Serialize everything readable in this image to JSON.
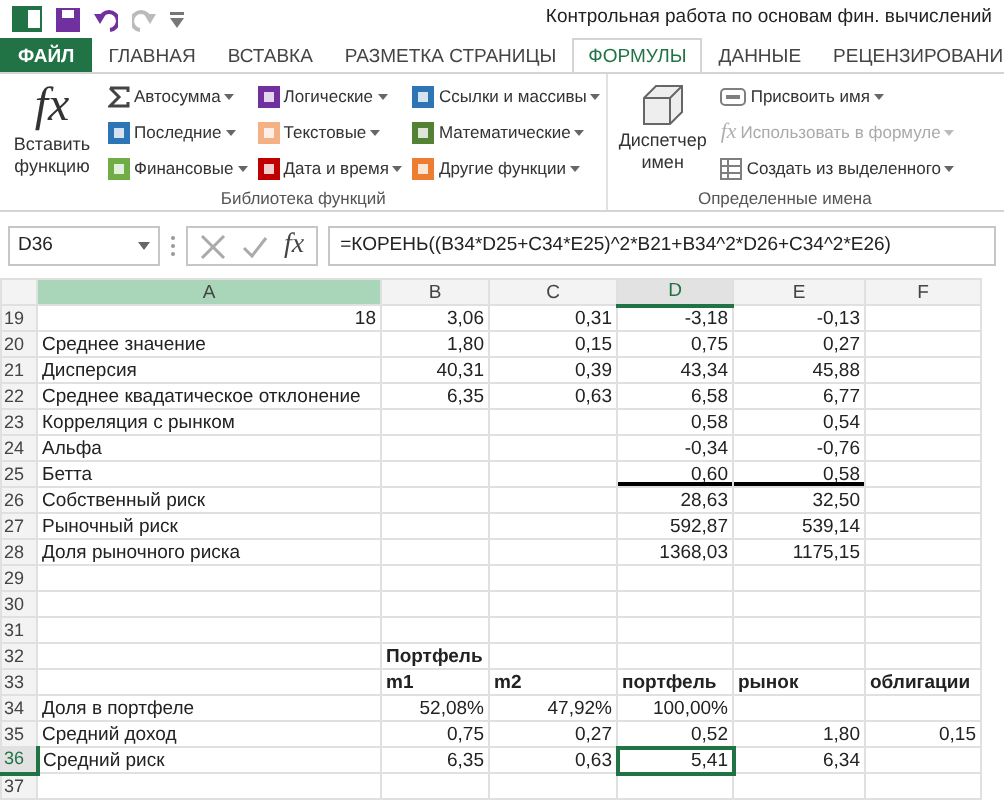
{
  "window": {
    "title": "Контрольная работа по основам фин. вычислений"
  },
  "tabs": [
    {
      "label": "ФАЙЛ",
      "kind": "file",
      "selected": false
    },
    {
      "label": "ГЛАВНАЯ",
      "kind": "tab",
      "selected": false
    },
    {
      "label": "ВСТАВКА",
      "kind": "tab",
      "selected": false
    },
    {
      "label": "РАЗМЕТКА СТРАНИЦЫ",
      "kind": "tab",
      "selected": false
    },
    {
      "label": "ФОРМУЛЫ",
      "kind": "tab",
      "selected": true
    },
    {
      "label": "ДАННЫЕ",
      "kind": "tab",
      "selected": false
    },
    {
      "label": "РЕЦЕНЗИРОВАНИ",
      "kind": "tab",
      "selected": false
    }
  ],
  "ribbon": {
    "groups": [
      {
        "label": "Библиотека функций",
        "big_button": {
          "label": "Вставить функцию",
          "kind": "fx",
          "icon_text": "fx"
        },
        "columns": [
          [
            {
              "label": "Автосумма",
              "kind": "sum",
              "color": "#444444",
              "disabled": false
            },
            {
              "label": "Последние",
              "kind": "box",
              "color": "#2e75b6",
              "disabled": false
            },
            {
              "label": "Финансовые",
              "kind": "box",
              "color": "#70ad47",
              "disabled": false
            }
          ],
          [
            {
              "label": "Логические",
              "kind": "box",
              "color": "#7030a0",
              "disabled": false
            },
            {
              "label": "Текстовые",
              "kind": "box",
              "color": "#f4b183",
              "disabled": false
            },
            {
              "label": "Дата и время",
              "kind": "box",
              "color": "#c00000",
              "disabled": false
            }
          ],
          [
            {
              "label": "Ссылки и массивы",
              "kind": "box",
              "color": "#2e75b6",
              "disabled": false
            },
            {
              "label": "Математические",
              "kind": "box",
              "color": "#548235",
              "disabled": false
            },
            {
              "label": "Другие функции",
              "kind": "box",
              "color": "#ed7d31",
              "disabled": false
            }
          ]
        ]
      },
      {
        "label": "Определенные имена",
        "big_button": {
          "label": "Диспетчер имен",
          "kind": "names"
        },
        "columns": [
          [
            {
              "label": "Присвоить имя",
              "kind": "tag",
              "color": "#7f7f7f",
              "disabled": false
            },
            {
              "label": "Использовать в формуле",
              "kind": "fx",
              "icon_text": "fx",
              "color": "#b0b0b0",
              "disabled": true
            },
            {
              "label": "Создать из выделенного",
              "kind": "grid",
              "color": "#7f7f7f",
              "disabled": false
            }
          ]
        ]
      }
    ]
  },
  "formula_bar": {
    "name_box": "D36",
    "insert_function": "fx",
    "formula": "=КОРЕНЬ((B34*D25+C34*E25)^2*B21+B34^2*D26+C34^2*E26)"
  },
  "columns": [
    {
      "label": "A",
      "selected": false,
      "highlighted": true
    },
    {
      "label": "B",
      "selected": false,
      "highlighted": false
    },
    {
      "label": "C",
      "selected": false,
      "highlighted": false
    },
    {
      "label": "D",
      "selected": true,
      "highlighted": false
    },
    {
      "label": "E",
      "selected": false,
      "highlighted": false
    },
    {
      "label": "F",
      "selected": false,
      "highlighted": false
    }
  ],
  "rows": [
    {
      "number": "19",
      "selected": false,
      "cells": [
        {
          "text": "18",
          "kind": "number",
          "selected": false
        },
        {
          "text": "3,06",
          "kind": "number",
          "selected": false
        },
        {
          "text": "0,31",
          "kind": "number",
          "selected": false
        },
        {
          "text": "-3,18",
          "kind": "number",
          "selected": false
        },
        {
          "text": "-0,13",
          "kind": "number",
          "selected": false
        },
        null
      ]
    },
    {
      "number": "20",
      "selected": false,
      "cells": [
        {
          "text": "Среднее значение",
          "kind": "label",
          "selected": false
        },
        {
          "text": "1,80",
          "kind": "number",
          "selected": false
        },
        {
          "text": "0,15",
          "kind": "number",
          "selected": false
        },
        {
          "text": "0,75",
          "kind": "number",
          "selected": false
        },
        {
          "text": "0,27",
          "kind": "number",
          "selected": false
        },
        null
      ]
    },
    {
      "number": "21",
      "selected": false,
      "cells": [
        {
          "text": "Дисперсия",
          "kind": "label",
          "selected": false
        },
        {
          "text": "40,31",
          "kind": "number",
          "selected": false
        },
        {
          "text": "0,39",
          "kind": "number",
          "selected": false
        },
        {
          "text": "43,34",
          "kind": "number",
          "selected": false
        },
        {
          "text": "45,88",
          "kind": "number",
          "selected": false
        },
        null
      ]
    },
    {
      "number": "22",
      "selected": false,
      "cells": [
        {
          "text": "Среднее квадатическое отклонение",
          "kind": "label",
          "selected": false
        },
        {
          "text": "6,35",
          "kind": "number",
          "selected": false
        },
        {
          "text": "0,63",
          "kind": "number",
          "selected": false
        },
        {
          "text": "6,58",
          "kind": "number",
          "selected": false
        },
        {
          "text": "6,77",
          "kind": "number",
          "selected": false
        },
        null
      ]
    },
    {
      "number": "23",
      "selected": false,
      "cells": [
        {
          "text": "Корреляция с рынком",
          "kind": "label",
          "selected": false
        },
        null,
        null,
        {
          "text": "0,58",
          "kind": "number",
          "selected": false
        },
        {
          "text": "0,54",
          "kind": "number",
          "selected": false
        },
        null
      ]
    },
    {
      "number": "24",
      "selected": false,
      "cells": [
        {
          "text": "Альфа",
          "kind": "label",
          "selected": false
        },
        null,
        null,
        {
          "text": "-0,34",
          "kind": "number",
          "selected": false
        },
        {
          "text": "-0,76",
          "kind": "number",
          "selected": false
        },
        null
      ]
    },
    {
      "number": "25",
      "selected": false,
      "cells": [
        {
          "text": "Бетта",
          "kind": "label",
          "selected": false
        },
        null,
        null,
        {
          "text": "0,60",
          "kind": "number",
          "selected": false,
          "bottom_border": true
        },
        {
          "text": "0,58",
          "kind": "number",
          "selected": false,
          "bottom_border": true
        },
        null
      ]
    },
    {
      "number": "26",
      "selected": false,
      "cells": [
        {
          "text": "Собственный риск",
          "kind": "label",
          "selected": false
        },
        null,
        null,
        {
          "text": "28,63",
          "kind": "number",
          "selected": false
        },
        {
          "text": "32,50",
          "kind": "number",
          "selected": false
        },
        null
      ]
    },
    {
      "number": "27",
      "selected": false,
      "cells": [
        {
          "text": "Рыночный риск",
          "kind": "label",
          "selected": false
        },
        null,
        null,
        {
          "text": "592,87",
          "kind": "number",
          "selected": false
        },
        {
          "text": "539,14",
          "kind": "number",
          "selected": false
        },
        null
      ]
    },
    {
      "number": "28",
      "selected": false,
      "cells": [
        {
          "text": "Доля рыночного риска",
          "kind": "label",
          "selected": false
        },
        null,
        null,
        {
          "text": "1368,03",
          "kind": "number",
          "selected": false
        },
        {
          "text": "1175,15",
          "kind": "number",
          "selected": false
        },
        null
      ]
    },
    {
      "number": "29",
      "selected": false
    },
    {
      "number": "30",
      "selected": false
    },
    {
      "number": "31",
      "selected": false
    },
    {
      "number": "32",
      "selected": false,
      "cells": [
        null,
        {
          "text": "Портфель",
          "kind": "header",
          "selected": false
        },
        null,
        null,
        null,
        null
      ]
    },
    {
      "number": "33",
      "selected": false,
      "cells": [
        null,
        {
          "text": "m1",
          "kind": "header",
          "selected": false
        },
        {
          "text": "m2",
          "kind": "header",
          "selected": false
        },
        {
          "text": "портфель",
          "kind": "header",
          "selected": false
        },
        {
          "text": "рынок",
          "kind": "header",
          "selected": false
        },
        {
          "text": "облигации",
          "kind": "header",
          "selected": false
        }
      ]
    },
    {
      "number": "34",
      "selected": false,
      "cells": [
        {
          "text": "Доля в портфеле",
          "kind": "label",
          "selected": false
        },
        {
          "text": "52,08%",
          "kind": "number",
          "selected": false
        },
        {
          "text": "47,92%",
          "kind": "number",
          "selected": false
        },
        {
          "text": "100,00%",
          "kind": "number",
          "selected": false
        },
        null,
        null
      ]
    },
    {
      "number": "35",
      "selected": false,
      "cells": [
        {
          "text": "Средний доход",
          "kind": "label",
          "selected": false
        },
        {
          "text": "0,75",
          "kind": "number",
          "selected": false
        },
        {
          "text": "0,27",
          "kind": "number",
          "selected": false
        },
        {
          "text": "0,52",
          "kind": "number",
          "selected": false
        },
        {
          "text": "1,80",
          "kind": "number",
          "selected": false
        },
        {
          "text": "0,15",
          "kind": "number",
          "selected": false
        }
      ]
    },
    {
      "number": "36",
      "selected": true,
      "cells": [
        {
          "text": "Средний риск",
          "kind": "label",
          "selected": false
        },
        {
          "text": "6,35",
          "kind": "number",
          "selected": false
        },
        {
          "text": "0,63",
          "kind": "number",
          "selected": false
        },
        {
          "text": "5,41",
          "kind": "number",
          "selected": true
        },
        {
          "text": "6,34",
          "kind": "number",
          "selected": false
        },
        null
      ]
    },
    {
      "number": "37",
      "selected": false
    }
  ]
}
